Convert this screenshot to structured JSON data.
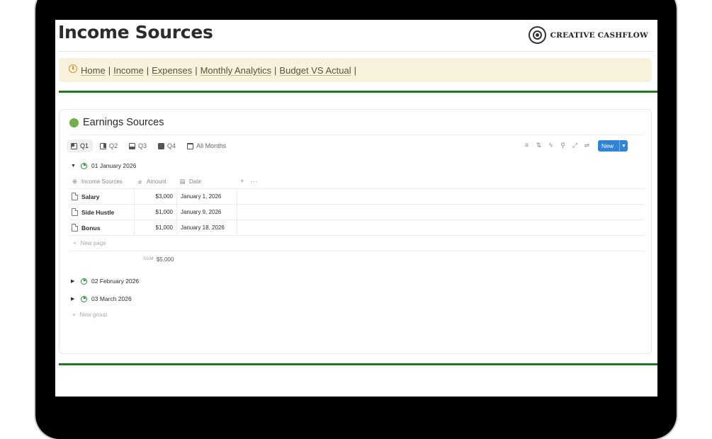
{
  "header": {
    "title": "Income Sources",
    "brand": "CREATIVE CASHFLOW"
  },
  "nav": {
    "links": [
      "Home",
      "Income",
      "Expenses",
      "Monthly Analytics",
      "Budget VS Actual"
    ],
    "separator": "|"
  },
  "database": {
    "title": "Earnings Sources",
    "views": [
      "Q1",
      "Q2",
      "Q3",
      "Q4",
      "All Months"
    ],
    "active_view": "Q1",
    "new_button": "New",
    "columns": {
      "name": "Income Sources",
      "amount": "Amount",
      "date": "Date"
    },
    "groups": [
      {
        "label": "01 January 2026",
        "expanded": true,
        "rows": [
          {
            "name": "Salary",
            "amount": "$3,000",
            "date": "January 1, 2026"
          },
          {
            "name": "Side Hustle",
            "amount": "$1,000",
            "date": "January 9, 2026"
          },
          {
            "name": "Bonus",
            "amount": "$1,000",
            "date": "January 18, 2026"
          }
        ],
        "new_page": "New page",
        "sum_label": "SUM",
        "sum_value": "$5,000"
      },
      {
        "label": "02 February 2026",
        "expanded": false
      },
      {
        "label": "03 March 2026",
        "expanded": false
      }
    ],
    "new_group": "New group"
  },
  "colors": {
    "accent_green": "#1f7a1f",
    "nav_bg": "#f8f2dc",
    "new_button": "#2f84d8",
    "dot_green": "#6fb04d"
  }
}
